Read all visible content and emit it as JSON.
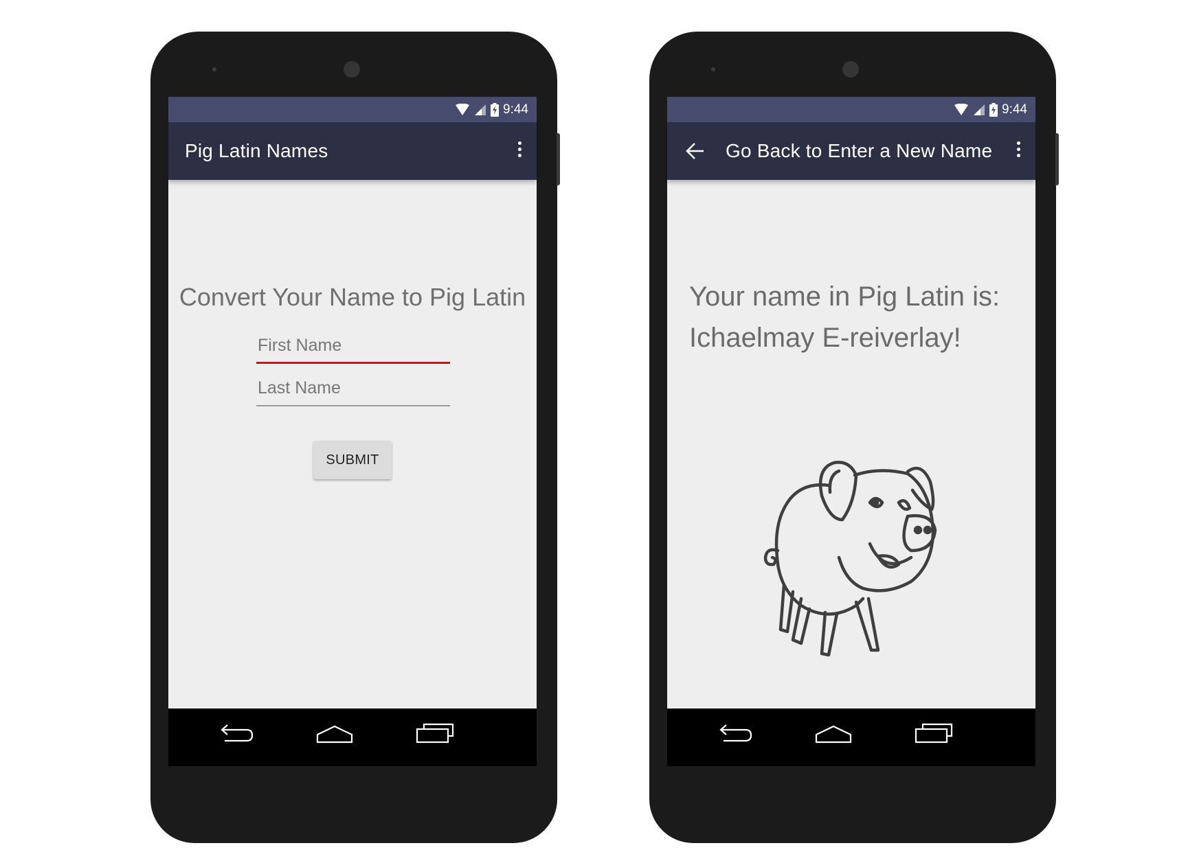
{
  "screens": [
    {
      "status_bar": {
        "time": "9:44"
      },
      "app_bar": {
        "title": "Pig Latin Names"
      },
      "content": {
        "heading": "Convert Your Name to Pig Latin",
        "first_name": {
          "placeholder": "First Name",
          "value": ""
        },
        "last_name": {
          "placeholder": "Last Name",
          "value": ""
        },
        "submit_label": "SUBMIT"
      }
    },
    {
      "status_bar": {
        "time": "9:44"
      },
      "app_bar": {
        "title": "Go Back to Enter a New Name"
      },
      "content": {
        "result_label": "Your name in Pig Latin is:",
        "result_value": "Ichaelmay E-reiverlay!"
      }
    }
  ],
  "colors": {
    "status_bar": "#474b6d",
    "app_bar": "#2d2f45",
    "content_bg": "#eeeeee",
    "focused_underline": "#b0201c",
    "phone_body": "#1b1b1b"
  },
  "icons": {
    "status": [
      "wifi-icon",
      "cell-signal-icon",
      "battery-charging-icon"
    ],
    "app_bar": [
      "back-arrow-icon",
      "overflow-menu-icon"
    ],
    "nav": [
      "back-nav-icon",
      "home-nav-icon",
      "recents-nav-icon"
    ]
  }
}
